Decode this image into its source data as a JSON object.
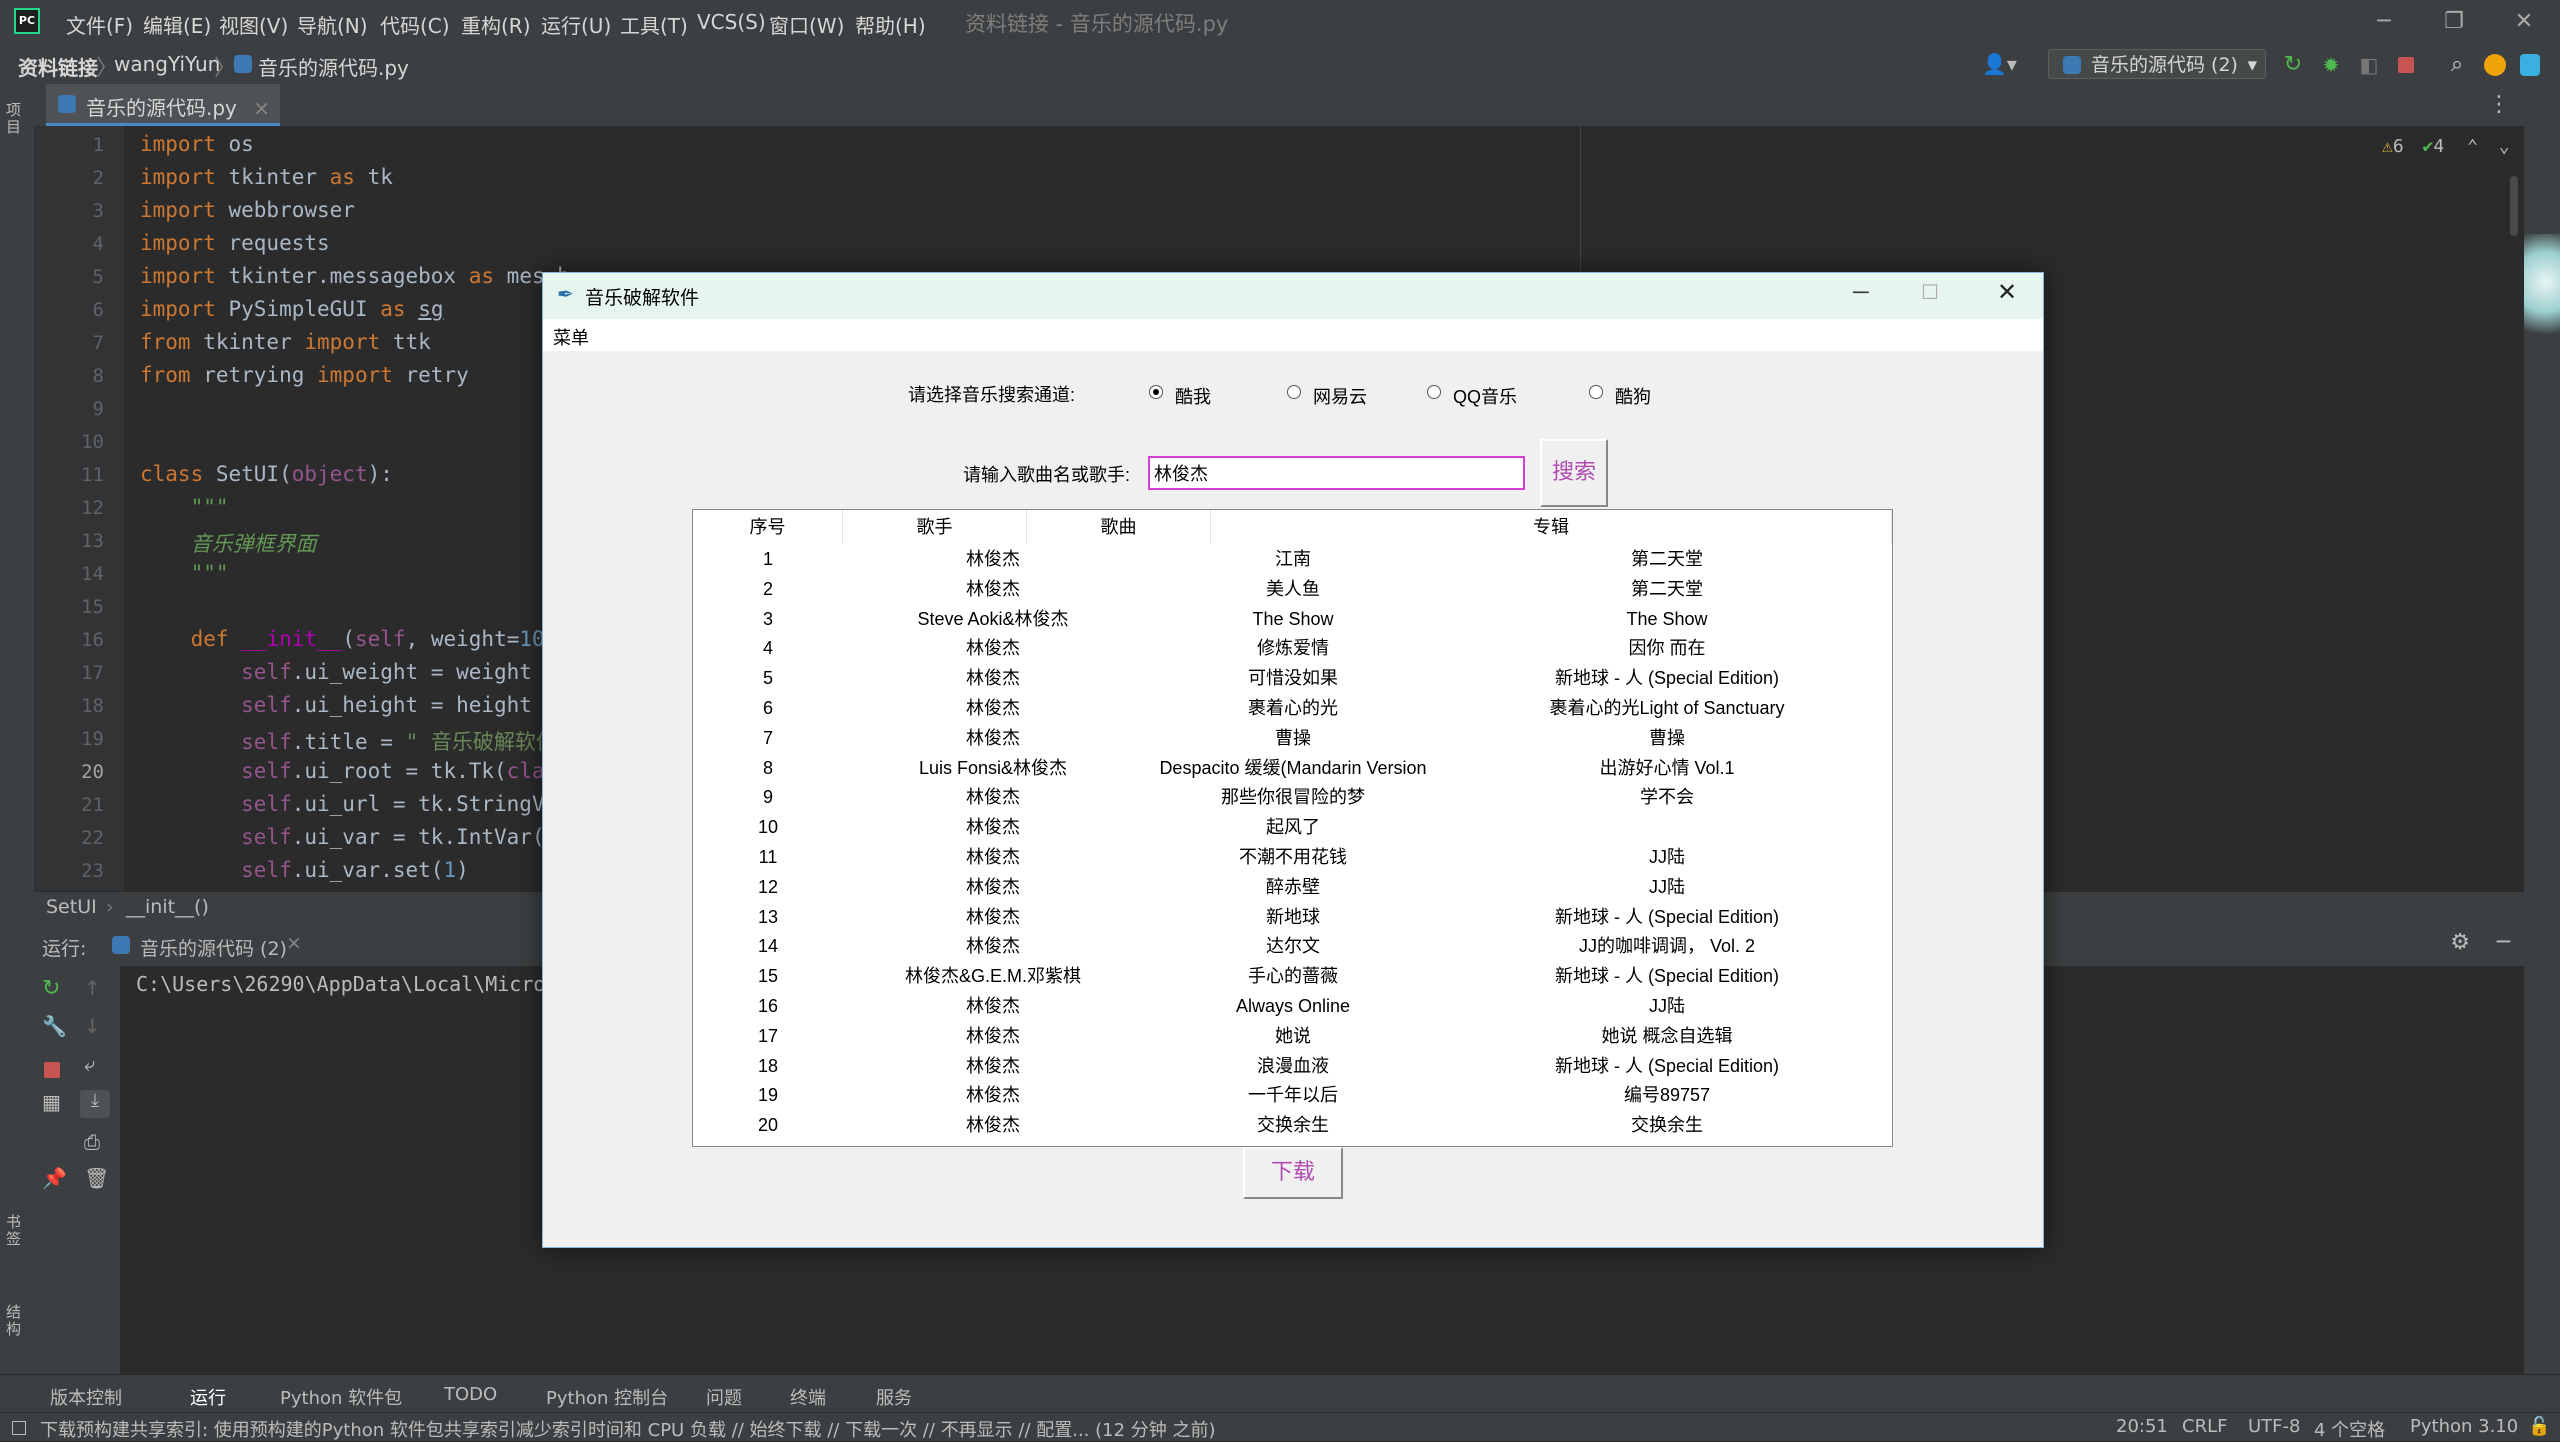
{
  "ide": {
    "menu": [
      "文件(F)",
      "编辑(E)",
      "视图(V)",
      "导航(N)",
      "代码(C)",
      "重构(R)",
      "运行(U)",
      "工具(T)",
      "VCS(S)",
      "窗口(W)",
      "帮助(H)"
    ],
    "window_title": "资料链接 - 音乐的源代码.py",
    "breadcrumb": [
      "资料链接",
      "wangYiYun",
      "音乐的源代码.py"
    ],
    "run_config": "音乐的源代码 (2)",
    "editor_tab": "音乐的源代码.py",
    "inspections": {
      "warnings": "6",
      "ok": "4"
    },
    "line_numbers": [
      "1",
      "2",
      "3",
      "4",
      "5",
      "6",
      "7",
      "8",
      "9",
      "10",
      "11",
      "12",
      "13",
      "14",
      "15",
      "16",
      "17",
      "18",
      "19",
      "20",
      "21",
      "22",
      "23"
    ],
    "code_crumb": [
      "SetUI",
      "__init__()"
    ],
    "run_label": "运行:",
    "run_tab": "音乐的源代码 (2)",
    "run_output": "C:\\Users\\26290\\AppData\\Local\\Micro",
    "left_tools": [
      "项目",
      "书签",
      "结构"
    ],
    "bottom_tabs": [
      "版本控制",
      "运行",
      "Python 软件包",
      "TODO",
      "Python 控制台",
      "问题",
      "终端",
      "服务"
    ],
    "status_message": "下载预构建共享索引: 使用预构建的Python 软件包共享索引减少索引时间和 CPU 负载 // 始终下载 // 下载一次 // 不再显示 // 配置... (12 分钟 之前)",
    "status_right": [
      "20:51",
      "CRLF",
      "UTF-8",
      "4 个空格",
      "Python 3.10"
    ]
  },
  "dialog": {
    "title": "音乐破解软件",
    "menu": "菜单",
    "channel_label": "请选择音乐搜索通道:",
    "channels": [
      "酷我",
      "网易云",
      "QQ音乐",
      "酷狗"
    ],
    "selected_channel": "酷我",
    "search_label": "请输入歌曲名或歌手:",
    "search_value": "林俊杰",
    "search_button": "搜索",
    "download_button": "下载",
    "columns": [
      "序号",
      "歌手",
      "歌曲",
      "专辑"
    ],
    "rows": [
      [
        "1",
        "林俊杰",
        "江南",
        "第二天堂"
      ],
      [
        "2",
        "林俊杰",
        "美人鱼",
        "第二天堂"
      ],
      [
        "3",
        "Steve Aoki&林俊杰",
        "The Show",
        "The Show"
      ],
      [
        "4",
        "林俊杰",
        "修炼爱情",
        "因你 而在"
      ],
      [
        "5",
        "林俊杰",
        "可惜没如果",
        "新地球 - 人 (Special Edition)"
      ],
      [
        "6",
        "林俊杰",
        "裹着心的光",
        "裹着心的光Light of Sanctuary"
      ],
      [
        "7",
        "林俊杰",
        "曹操",
        "曹操"
      ],
      [
        "8",
        "Luis Fonsi&林俊杰",
        "Despacito 缓缓(Mandarin Version",
        "出游好心情 Vol.1"
      ],
      [
        "9",
        "林俊杰",
        "那些你很冒险的梦",
        "学不会"
      ],
      [
        "10",
        "林俊杰",
        "起风了",
        ""
      ],
      [
        "11",
        "林俊杰",
        "不潮不用花钱",
        "JJ陆"
      ],
      [
        "12",
        "林俊杰",
        "醉赤壁",
        "JJ陆"
      ],
      [
        "13",
        "林俊杰",
        "新地球",
        "新地球 - 人 (Special Edition)"
      ],
      [
        "14",
        "林俊杰",
        "达尔文",
        "JJ的咖啡调调， Vol. 2"
      ],
      [
        "15",
        "林俊杰&G.E.M.邓紫棋",
        "手心的蔷薇",
        "新地球 - 人 (Special Edition)"
      ],
      [
        "16",
        "林俊杰",
        "Always Online",
        "JJ陆"
      ],
      [
        "17",
        "林俊杰",
        "她说",
        "她说 概念自选辑"
      ],
      [
        "18",
        "林俊杰",
        "浪漫血液",
        "新地球 - 人 (Special Edition)"
      ],
      [
        "19",
        "林俊杰",
        "一千年以后",
        "编号89757"
      ],
      [
        "20",
        "林俊杰",
        "交换余生",
        "交换余生"
      ]
    ]
  }
}
